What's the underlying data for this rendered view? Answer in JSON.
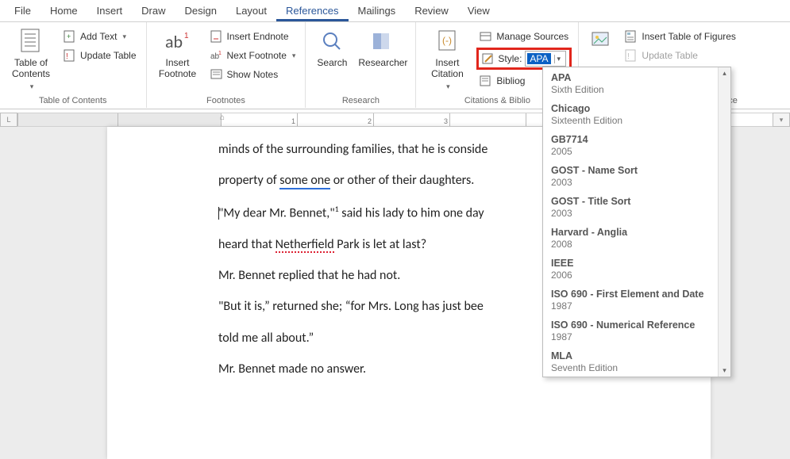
{
  "tabs": {
    "file": "File",
    "home": "Home",
    "insert": "Insert",
    "draw": "Draw",
    "design": "Design",
    "layout": "Layout",
    "references": "References",
    "mailings": "Mailings",
    "review": "Review",
    "view": "View"
  },
  "ribbon": {
    "toc": {
      "big": "Table of\nContents",
      "add_text": "Add Text",
      "update_table": "Update Table",
      "group": "Table of Contents"
    },
    "fn": {
      "big": "Insert\nFootnote",
      "endnote": "Insert Endnote",
      "next": "Next Footnote",
      "show": "Show Notes",
      "group": "Footnotes"
    },
    "research": {
      "search": "Search",
      "researcher": "Researcher",
      "group": "Research"
    },
    "cit": {
      "big": "Insert\nCitation",
      "manage": "Manage Sources",
      "style_lbl": "Style:",
      "style_val": "APA",
      "biblio": "Bibliog",
      "group": "Citations & Biblio",
      "nce": "nce"
    },
    "cap": {
      "insert_tof": "Insert Table of Figures",
      "update_table": "Update Table"
    }
  },
  "style_dropdown": [
    {
      "name": "APA",
      "sub": "Sixth Edition"
    },
    {
      "name": "Chicago",
      "sub": "Sixteenth Edition"
    },
    {
      "name": "GB7714",
      "sub": "2005"
    },
    {
      "name": "GOST - Name Sort",
      "sub": "2003"
    },
    {
      "name": "GOST - Title Sort",
      "sub": "2003"
    },
    {
      "name": "Harvard - Anglia",
      "sub": "2008"
    },
    {
      "name": "IEEE",
      "sub": "2006"
    },
    {
      "name": "ISO 690 - First Element and Date",
      "sub": "1987"
    },
    {
      "name": "ISO 690 - Numerical Reference",
      "sub": "1987"
    },
    {
      "name": "MLA",
      "sub": "Seventh Edition"
    }
  ],
  "ruler": {
    "left_label": "L",
    "nums": [
      "1",
      "2",
      "3"
    ]
  },
  "doc": {
    "line1a": "minds of the surrounding families, that he is conside",
    "line2a": "property of ",
    "line2b": "some one",
    "line2c": " or other of their daughters.",
    "line3a": "\"My dear Mr. Bennet,\"",
    "line3sup": "1",
    "line3b": " said his lady to him one day",
    "line4a": "heard that ",
    "line4b": "Netherfield",
    "line4c": " Park is let at last?",
    "line5": "Mr. Bennet replied that he had not.",
    "line6": "\"But it is,” returned she; “for Mrs. Long has just bee",
    "line7": "told me all about.”",
    "line8": "Mr. Bennet made no answer."
  }
}
